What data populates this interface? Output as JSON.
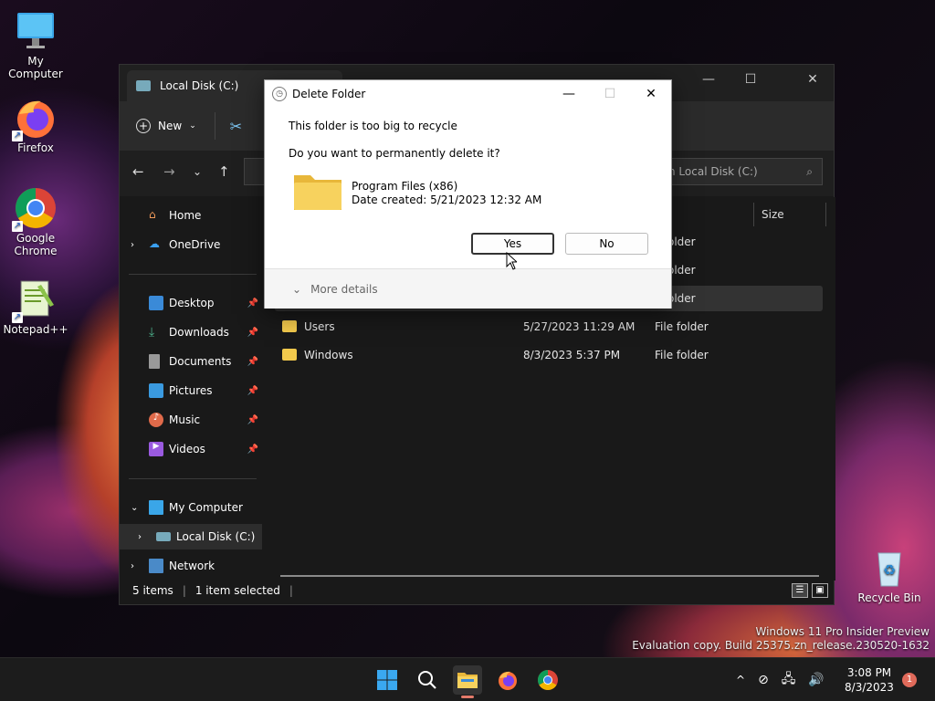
{
  "desktop": {
    "icons": [
      {
        "label": "My Computer"
      },
      {
        "label": "Firefox"
      },
      {
        "label": "Google Chrome"
      },
      {
        "label": "Notepad++"
      },
      {
        "label": "Recycle Bin"
      }
    ],
    "watermark_line1": "Windows 11 Pro Insider Preview",
    "watermark_line2": "Evaluation copy. Build 25375.zn_release.230520-1632"
  },
  "explorer": {
    "tab_title": "Local Disk (C:)",
    "new_label": "New",
    "search_placeholder": "h Local Disk (C:)",
    "sidebar": {
      "home": "Home",
      "onedrive": "OneDrive",
      "desktop": "Desktop",
      "downloads": "Downloads",
      "documents": "Documents",
      "pictures": "Pictures",
      "music": "Music",
      "videos": "Videos",
      "my_computer": "My Computer",
      "local_disk": "Local Disk (C:)",
      "network": "Network"
    },
    "columns": {
      "size": "Size"
    },
    "rows": [
      {
        "name": "",
        "date": "",
        "type": "older"
      },
      {
        "name": "",
        "date": "",
        "type": "older"
      },
      {
        "name": "",
        "date": "",
        "type": "older"
      },
      {
        "name": "Users",
        "date": "5/27/2023 11:29 AM",
        "type": "File folder"
      },
      {
        "name": "Windows",
        "date": "8/3/2023 5:37 PM",
        "type": "File folder"
      }
    ],
    "status_items": "5 items",
    "status_selected": "1 item selected"
  },
  "dialog": {
    "title": "Delete Folder",
    "message1": "This folder is too big to recycle",
    "message2": "Do you want to permanently delete it?",
    "folder_name": "Program Files (x86)",
    "folder_date": "Date created: 5/21/2023 12:32 AM",
    "yes_label": "Yes",
    "no_label": "No",
    "more_details": "More details"
  },
  "taskbar": {
    "time": "3:08 PM",
    "date": "8/3/2023",
    "notification_count": "1"
  },
  "colors": {
    "accent": "#0078d4",
    "folder": "#f2c94c"
  }
}
